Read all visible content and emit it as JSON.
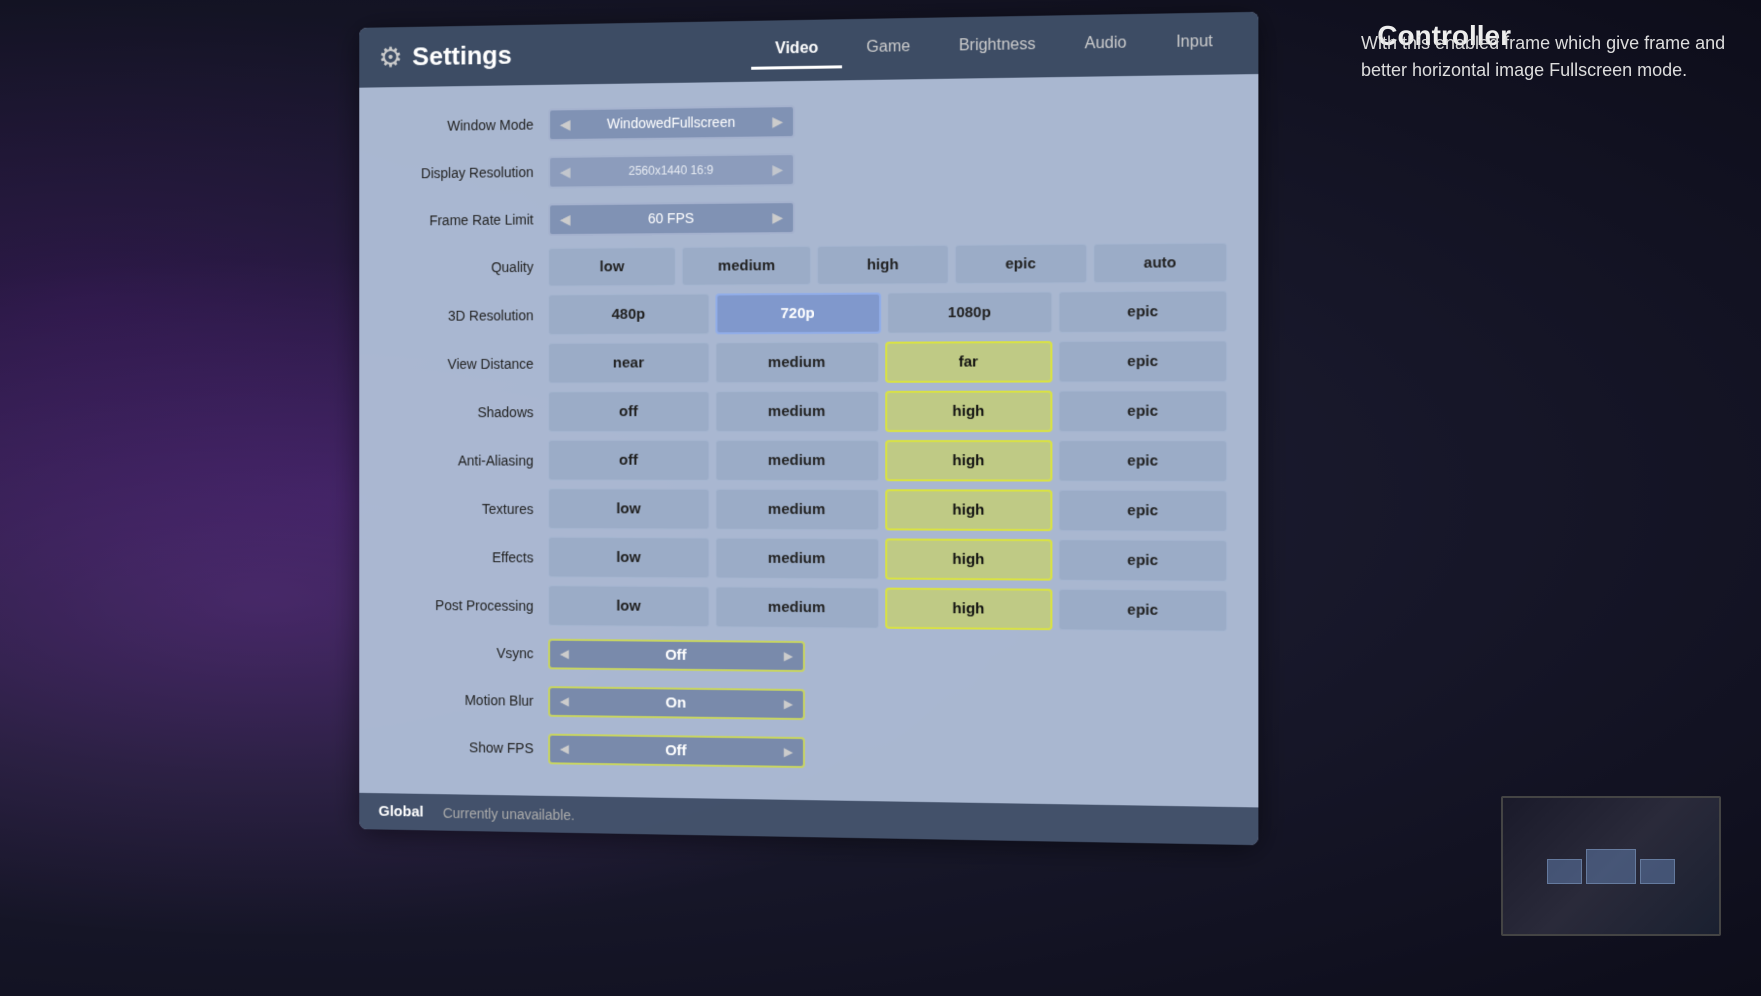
{
  "header": {
    "title": "Settings",
    "icon": "⚙"
  },
  "tabs": [
    {
      "label": "Video",
      "active": true
    },
    {
      "label": "Game",
      "active": false
    },
    {
      "label": "Brightness",
      "active": false
    },
    {
      "label": "Audio",
      "active": false
    },
    {
      "label": "Input",
      "active": false
    },
    {
      "label": "Controller",
      "active": false
    }
  ],
  "settings": {
    "windowMode": {
      "label": "Window Mode",
      "value": "WindowedFullscreen"
    },
    "displayResolution": {
      "label": "Display Resolution",
      "value": "2560x1440 16:9"
    },
    "frameRateLimit": {
      "label": "Frame Rate Limit",
      "value": "60 FPS"
    },
    "quality": {
      "label": "Quality",
      "options": [
        "low",
        "medium",
        "high",
        "epic",
        "auto"
      ],
      "selected": null
    },
    "resolution3D": {
      "label": "3D Resolution",
      "options": [
        "480p",
        "720p",
        "1080p",
        "epic"
      ],
      "selected": "720p"
    },
    "viewDistance": {
      "label": "View Distance",
      "options": [
        "near",
        "medium",
        "far",
        "epic"
      ],
      "selected": "far"
    },
    "shadows": {
      "label": "Shadows",
      "options": [
        "off",
        "medium",
        "high",
        "epic"
      ],
      "selected": "high"
    },
    "antiAliasing": {
      "label": "Anti-Aliasing",
      "options": [
        "off",
        "medium",
        "high",
        "epic"
      ],
      "selected": "high"
    },
    "textures": {
      "label": "Textures",
      "options": [
        "low",
        "medium",
        "high",
        "epic"
      ],
      "selected": "high"
    },
    "effects": {
      "label": "Effects",
      "options": [
        "low",
        "medium",
        "high",
        "epic"
      ],
      "selected": "high"
    },
    "postProcessing": {
      "label": "Post Processing",
      "options": [
        "low",
        "medium",
        "high",
        "epic"
      ],
      "selected": "high"
    },
    "vsync": {
      "label": "Vsync",
      "value": "Off"
    },
    "motionBlur": {
      "label": "Motion Blur",
      "value": "On"
    },
    "showFPS": {
      "label": "Show FPS",
      "value": "Off"
    }
  },
  "footer": {
    "global": "Global",
    "status": "Currently unavailable."
  },
  "description": {
    "text": "With this enabled frame which give frame and better horizontal image Fullscreen mode."
  },
  "controllerTab": "Controller"
}
